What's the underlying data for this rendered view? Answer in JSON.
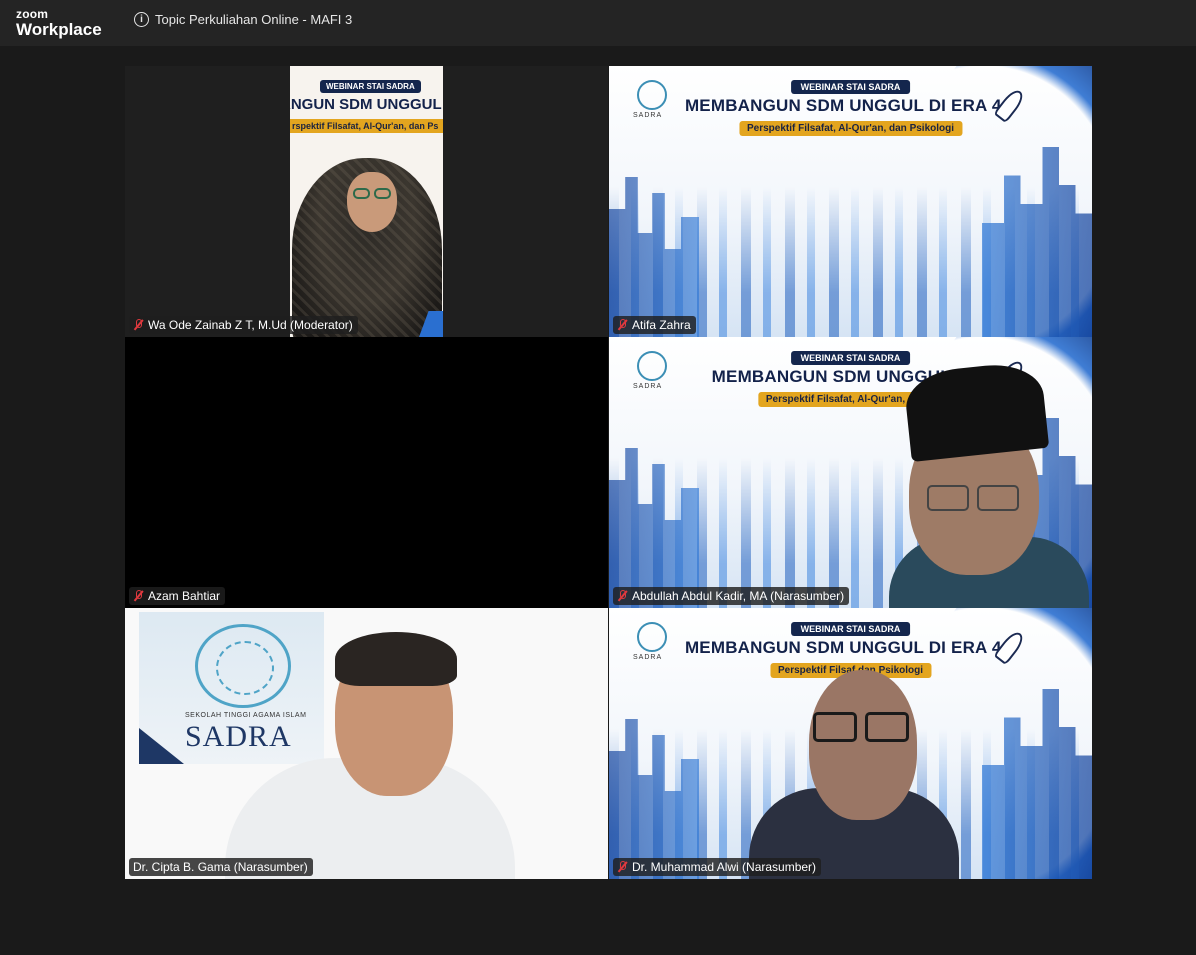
{
  "app": {
    "logo_line1": "zoom",
    "logo_line2": "Workplace",
    "meeting_title": "Topic Perkuliahan Online - MAFI 3",
    "info_icon": "info-icon"
  },
  "slide": {
    "banner": "WEBINAR STAI SADRA",
    "headline": "MEMBANGUN SDM UNGGUL DI ERA 4.0",
    "subline": "Perspektif Filsafat, Al-Qur'an, dan Psikologi",
    "headline_partial": "ANGUN SDM UNGGUL DI",
    "subline_partial": "rspektif Filsafat, Al-Qur'an, dan Ps",
    "headline_cut": "MEMBANGUN SDM UNGGUL DI E",
    "subline_cut": "Perspektif Filsafat, Al-Qur'an, dan P",
    "subline_cut2": "Perspektif Filsaf       dan Psikologi",
    "seal_label": "SADRA"
  },
  "sadra_logo": {
    "small": "SEKOLAH TINGGI AGAMA ISLAM",
    "big": "SADRA"
  },
  "participants": [
    {
      "name": "Wa Ode Zainab Z T, M.Ud (Moderator)",
      "muted": true,
      "active": false
    },
    {
      "name": "Atifa Zahra",
      "muted": true,
      "active": false
    },
    {
      "name": "Azam Bahtiar",
      "muted": true,
      "active": false
    },
    {
      "name": "Abdullah Abdul Kadir, MA (Narasumber)",
      "muted": true,
      "active": false
    },
    {
      "name": "Dr. Cipta B. Gama (Narasumber)",
      "muted": false,
      "active": true
    },
    {
      "name": "Dr. Muhammad Alwi (Narasumber)",
      "muted": true,
      "active": false
    }
  ],
  "colors": {
    "background": "#1a1a1a",
    "titlebar": "#242424",
    "active_speaker": "#2ecc85",
    "muted": "#e0393e"
  }
}
